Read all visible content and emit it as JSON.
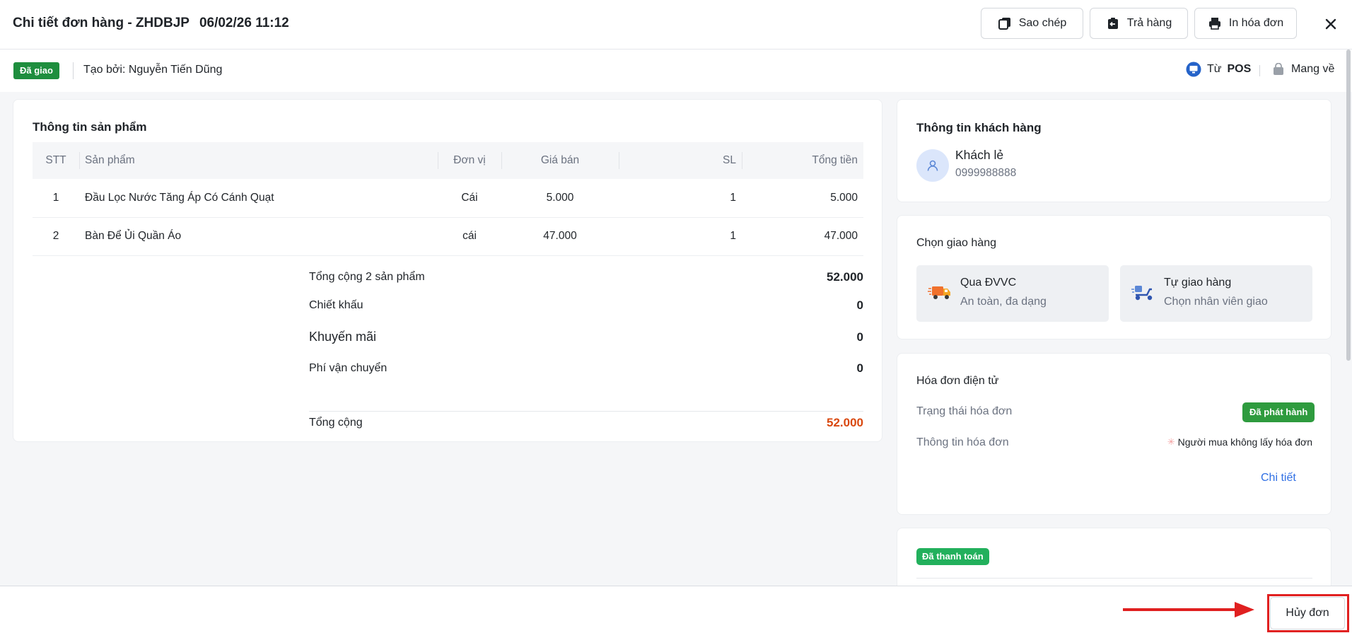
{
  "header": {
    "title": "Chi tiết đơn hàng - ZHDBJP",
    "datetime": "06/02/26 11:12",
    "buttons": {
      "copy": "Sao chép",
      "return": "Trả hàng",
      "print": "In hóa đơn"
    }
  },
  "status": {
    "badge": "Đã giao",
    "created_by": "Tạo bởi: Nguyễn Tiến Dũng",
    "source_prefix": "Từ",
    "source": "POS",
    "takeaway": "Mang về"
  },
  "products": {
    "title": "Thông tin sản phẩm",
    "columns": [
      "STT",
      "Sản phẩm",
      "Đơn vị",
      "Giá bán",
      "SL",
      "Tổng tiền"
    ],
    "rows": [
      {
        "stt": "1",
        "name": "Đầu Lọc Nước Tăng Áp Có Cánh Quạt",
        "unit": "Cái",
        "price": "5.000",
        "qty": "1",
        "total": "5.000"
      },
      {
        "stt": "2",
        "name": "Bàn Để Ủi Quần Áo",
        "unit": "cái",
        "price": "47.000",
        "qty": "1",
        "total": "47.000"
      }
    ],
    "summary": {
      "subtotal_label": "Tổng cộng 2 sản phẩm",
      "subtotal": "52.000",
      "discount_label": "Chiết khấu",
      "discount": "0",
      "promo_label": "Khuyến mãi",
      "promo": "0",
      "shipping_label": "Phí vận chuyển",
      "shipping": "0",
      "total_label": "Tổng cộng",
      "total": "52.000"
    }
  },
  "customer": {
    "title": "Thông tin khách hàng",
    "name": "Khách lẻ",
    "phone": "0999988888"
  },
  "delivery": {
    "title": "Chọn giao hàng",
    "options": [
      {
        "title": "Qua ĐVVC",
        "subtitle": "An toàn, đa dạng",
        "icon": "delivery-truck-icon"
      },
      {
        "title": "Tự giao hàng",
        "subtitle": "Chọn nhân viên giao",
        "icon": "scooter-icon"
      }
    ]
  },
  "einvoice": {
    "title": "Hóa đơn điện tử",
    "status_label": "Trạng thái hóa đơn",
    "status_value": "Đã phát hành",
    "info_label": "Thông tin hóa đơn",
    "info_value": "Người mua không lấy hóa đơn",
    "detail_link": "Chi tiết"
  },
  "payment": {
    "badge": "Đã thanh toán"
  },
  "footer": {
    "cancel": "Hủy đơn"
  },
  "colors": {
    "green": "#1e8e3e",
    "total_red": "#d9480f",
    "link_blue": "#2f6fe4",
    "highlight_red": "#e02020"
  }
}
